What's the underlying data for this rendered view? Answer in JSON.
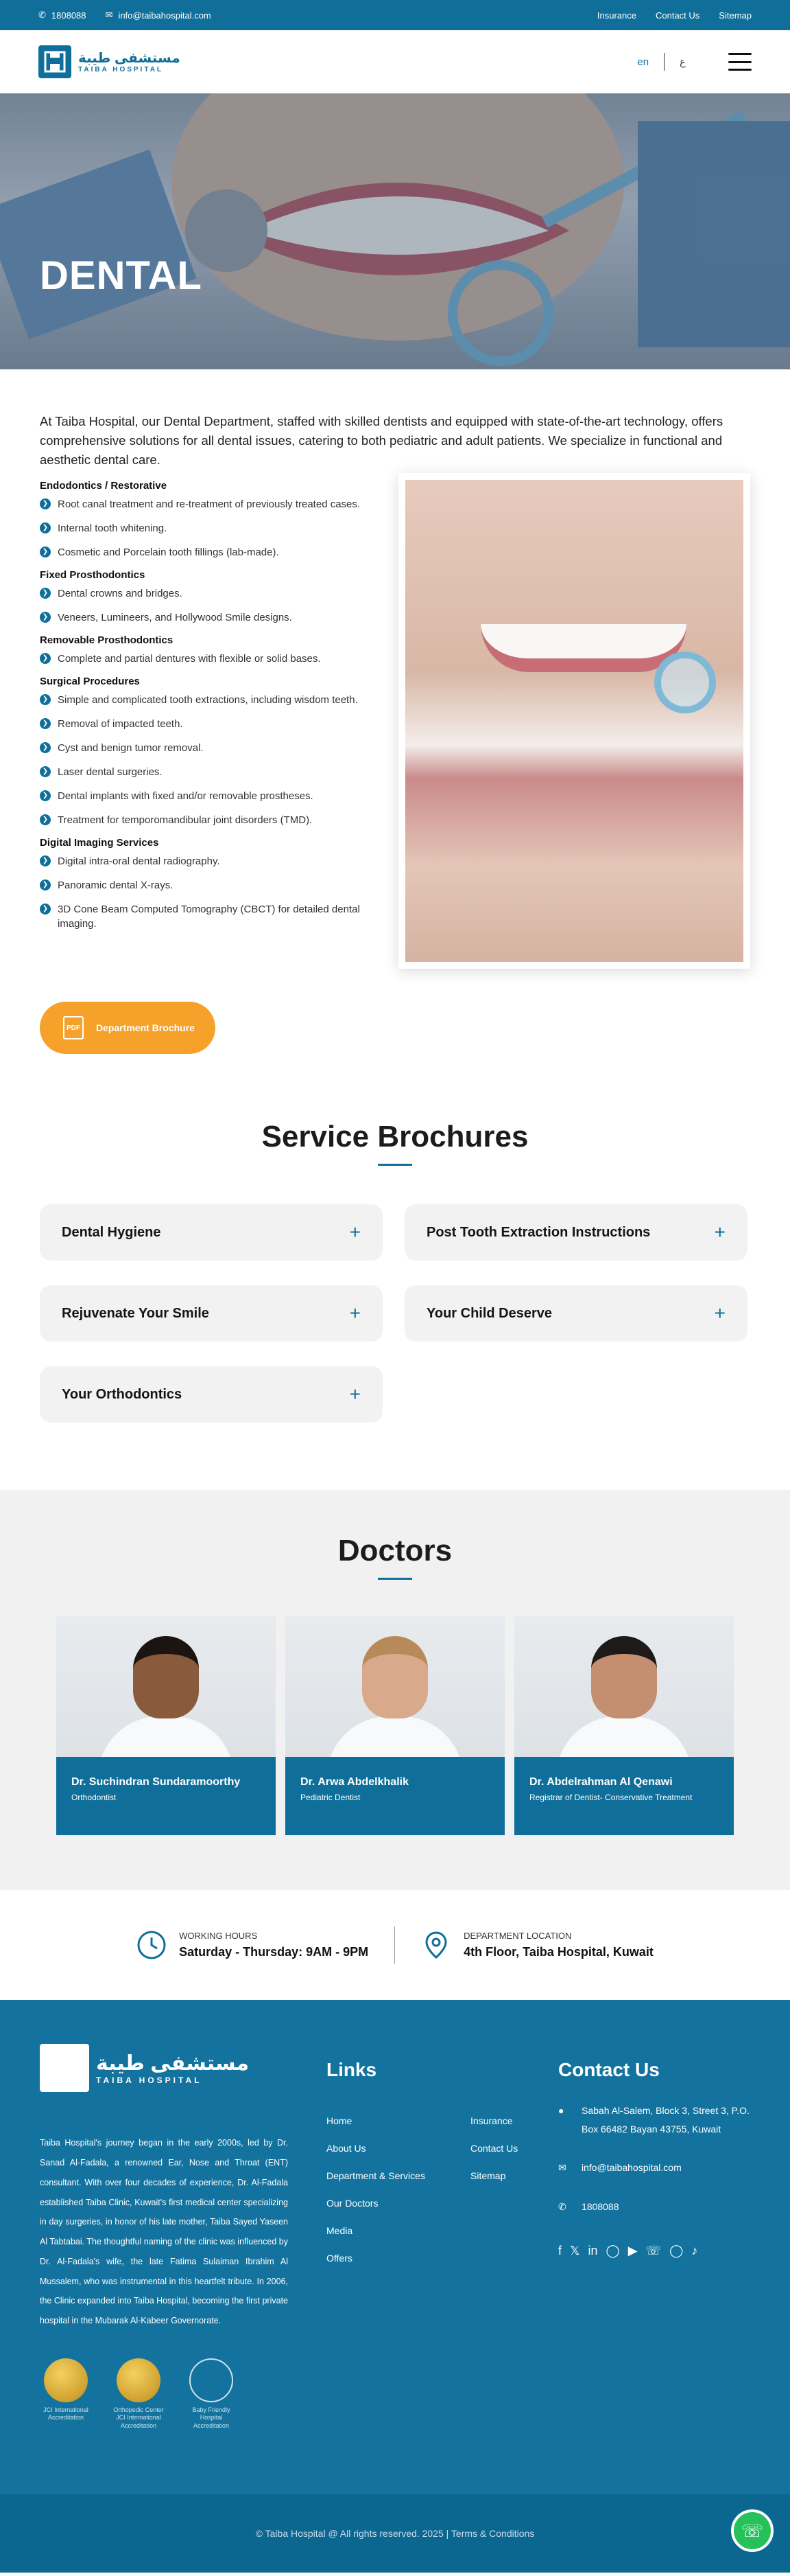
{
  "topbar": {
    "phone": "1808088",
    "email": "info@taibahospital.com",
    "links": [
      "Insurance",
      "Contact Us",
      "Sitemap"
    ]
  },
  "header": {
    "logo_ar": "مستشفى طيبة",
    "logo_en": "TAIBA HOSPITAL",
    "lang_en": "en",
    "lang_ar": "ع"
  },
  "hero": {
    "title": "DENTAL"
  },
  "intro": "At Taiba Hospital, our Dental Department, staffed with skilled dentists and equipped with state-of-the-art technology, offers comprehensive solutions for all dental issues, catering to both pediatric and adult patients. We specialize in functional and aesthetic dental care.",
  "services": [
    {
      "heading": "Endodontics / Restorative",
      "items": [
        "Root canal treatment and re-treatment of previously treated cases.",
        "Internal tooth whitening.",
        "Cosmetic and Porcelain tooth fillings (lab-made)."
      ]
    },
    {
      "heading": "Fixed Prosthodontics",
      "items": [
        "Dental crowns and bridges.",
        "Veneers, Lumineers, and Hollywood Smile designs."
      ]
    },
    {
      "heading": "Removable Prosthodontics",
      "items": [
        "Complete and partial dentures with flexible or solid bases."
      ]
    },
    {
      "heading": "Surgical Procedures",
      "items": [
        "Simple and complicated tooth extractions, including wisdom teeth.",
        "Removal of impacted teeth.",
        "Cyst and benign tumor removal.",
        "Laser dental surgeries.",
        "Dental implants with fixed and/or removable prostheses.",
        "Treatment for temporomandibular joint disorders (TMD)."
      ]
    },
    {
      "heading": "Digital Imaging Services",
      "items": [
        "Digital intra-oral dental radiography.",
        "Panoramic dental X-rays.",
        "3D Cone Beam Computed Tomography (CBCT) for detailed dental imaging."
      ]
    }
  ],
  "brochure_button": "Department Brochure",
  "brochures": {
    "title": "Service Brochures",
    "items": [
      "Dental Hygiene",
      "Post Tooth Extraction Instructions",
      "Rejuvenate Your Smile",
      "Your Child Deserve",
      "Your Orthodontics"
    ]
  },
  "doctors": {
    "title": "Doctors",
    "list": [
      {
        "name": "Dr. Suchindran Sundaramoorthy",
        "role": "Orthodontist",
        "skin": "#8a5a3c",
        "hair": "#1b1410"
      },
      {
        "name": "Dr. Arwa Abdelkhalik",
        "role": "Pediatric Dentist",
        "skin": "#d9a98b",
        "hair": "#b88a5a"
      },
      {
        "name": "Dr. Abdelrahman Al Qenawi",
        "role": "Registrar of Dentist- Conservative Treatment",
        "skin": "#c48f70",
        "hair": "#1d1a19"
      }
    ]
  },
  "strip": {
    "hours_label": "WORKING HOURS",
    "hours_value": "Saturday - Thursday: 9AM - 9PM",
    "location_label": "DEPARTMENT LOCATION",
    "location_value": "4th Floor, Taiba Hospital, Kuwait"
  },
  "footer": {
    "about": "Taiba Hospital's journey began in the early 2000s, led by Dr. Sanad Al-Fadala, a renowned Ear, Nose and Throat (ENT) consultant. With over four decades of experience, Dr. Al-Fadala established Taiba Clinic, Kuwait's first medical center specializing in day surgeries, in honor of his late mother, Taiba Sayed Yaseen Al Tabtabai. The thoughtful naming of the clinic was influenced by Dr. Al-Fadala's wife, the late Fatima Sulaiman Ibrahim Al Mussalem, who was instrumental in this heartfelt tribute. In 2006, the Clinic expanded into Taiba Hospital, becoming the first private hospital in the Mubarak Al-Kabeer Governorate.",
    "badges": [
      "JCI International Accreditation",
      "Orthopedic Center JCI International Accreditation",
      "Baby Friendly Hospital Accreditation"
    ],
    "links_title": "Links",
    "links": [
      "Home",
      "Insurance",
      "About Us",
      "Contact Us",
      "Department & Services",
      "Sitemap",
      "Our Doctors",
      "",
      "Media",
      "",
      "Offers",
      ""
    ],
    "contact_title": "Contact Us",
    "address": "Sabah Al-Salem, Block 3, Street 3, P.O. Box 66482 Bayan 43755, Kuwait",
    "email": "info@taibahospital.com",
    "phone": "1808088",
    "copyright": "© Taiba Hospital @ All rights reserved. 2025 | Terms & Conditions"
  }
}
